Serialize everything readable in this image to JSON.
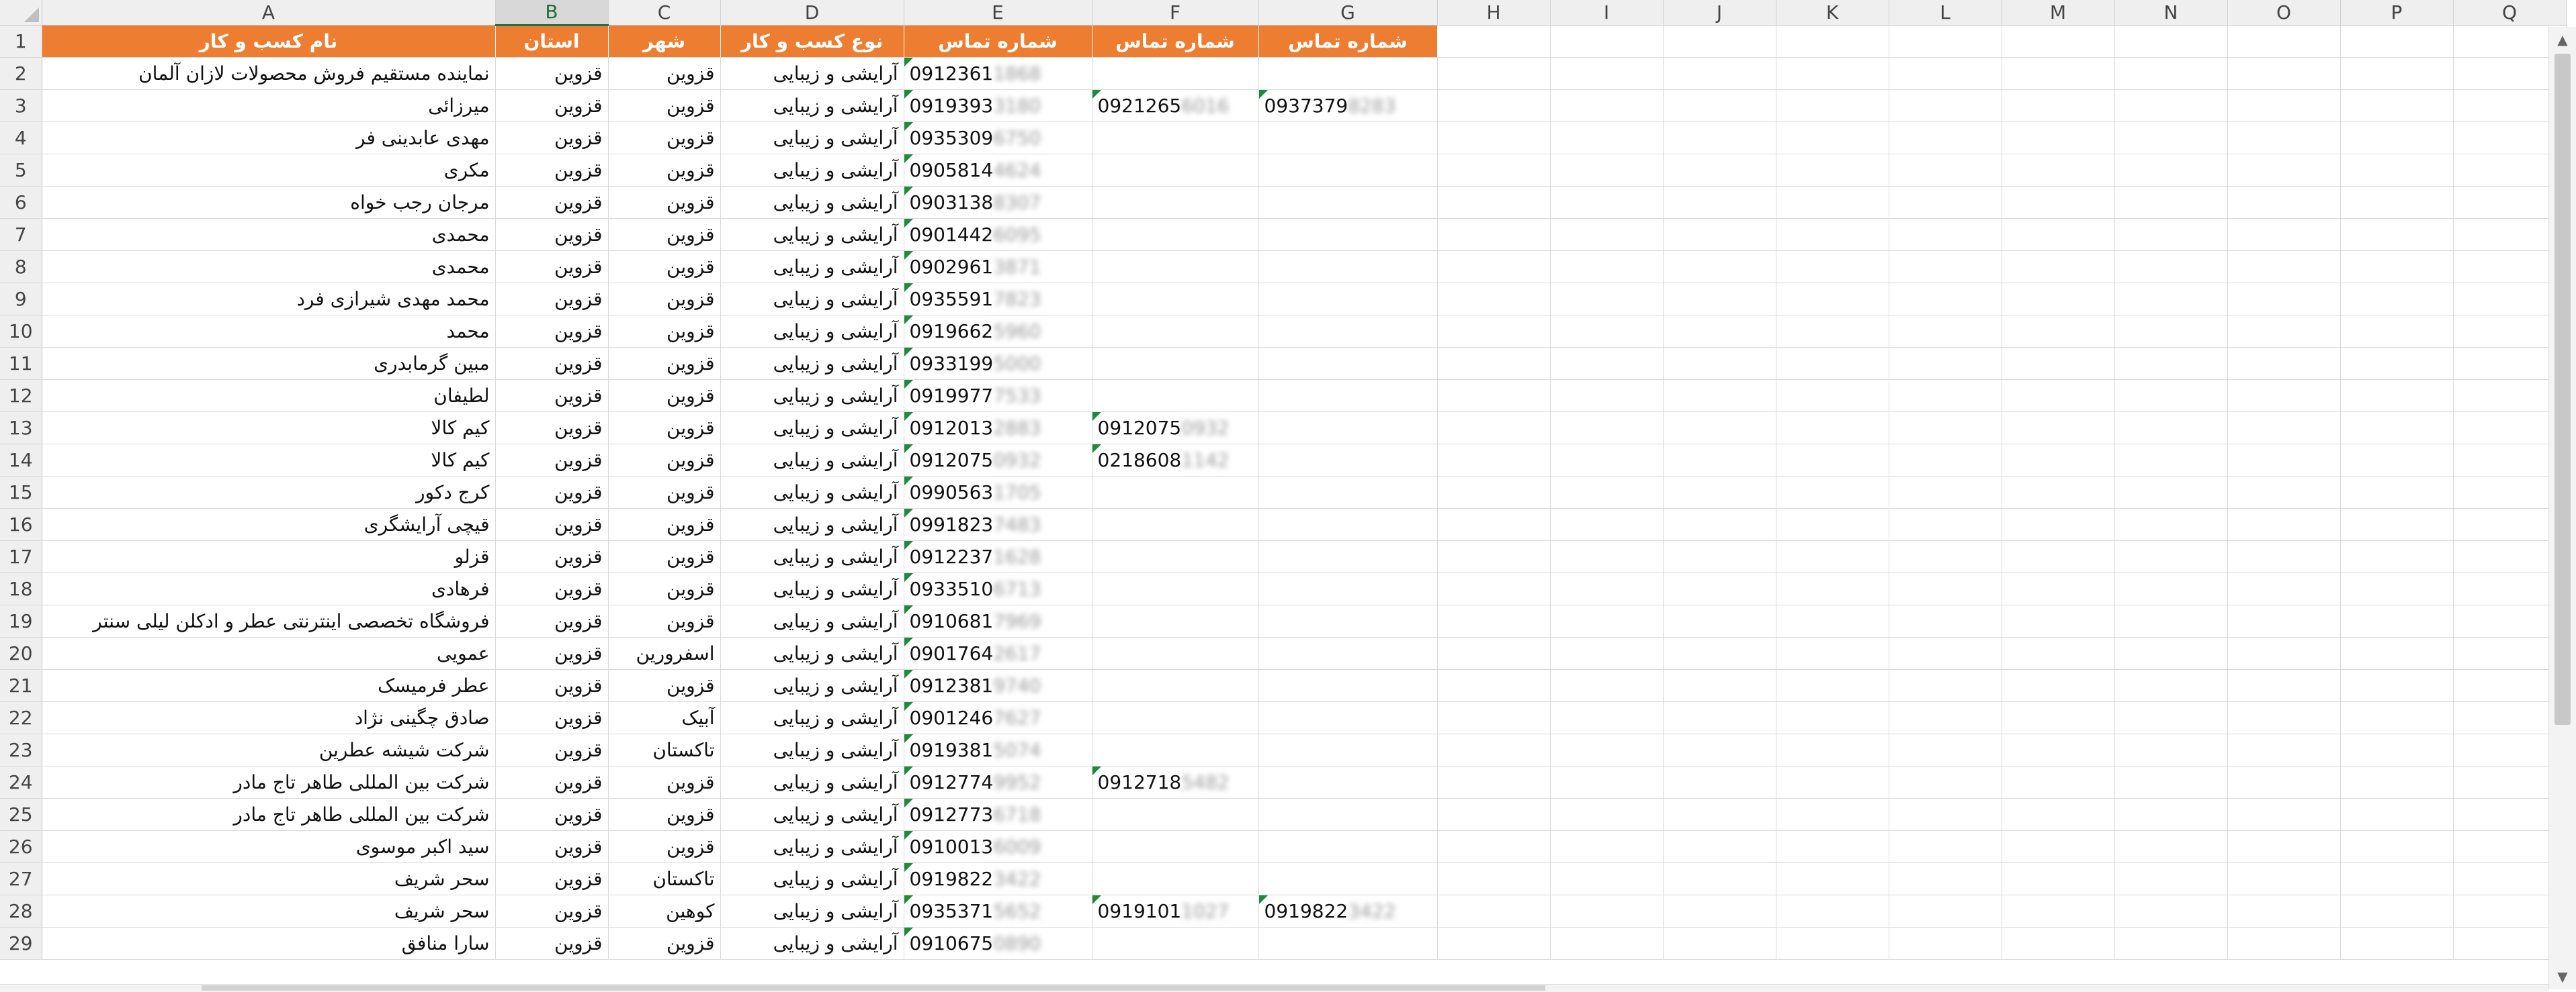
{
  "columns": [
    "A",
    "B",
    "C",
    "D",
    "E",
    "F",
    "G",
    "H",
    "I",
    "J",
    "K",
    "L",
    "M",
    "N",
    "O",
    "P",
    "Q"
  ],
  "selected_column": "B",
  "header_row": [
    "نام کسب و کار",
    "استان",
    "شهر",
    "نوع کسب و کار",
    "شماره تماس",
    "شماره تماس",
    "شماره تماس"
  ],
  "rows": [
    {
      "n": "2",
      "a": "نماینده مستقیم فروش محصولات لازان آلمان",
      "b": "قزوین",
      "c": "قزوین",
      "d": "آرایشی و زیبایی",
      "e": [
        "0912361",
        "1868"
      ],
      "f": null,
      "g": null
    },
    {
      "n": "3",
      "a": "میرزائی",
      "b": "قزوین",
      "c": "قزوین",
      "d": "آرایشی و زیبایی",
      "e": [
        "0919393",
        "3180"
      ],
      "f": [
        "0921265",
        "6016"
      ],
      "g": [
        "0937379",
        "8283"
      ]
    },
    {
      "n": "4",
      "a": "مهدی عابدینی فر",
      "b": "قزوین",
      "c": "قزوین",
      "d": "آرایشی و زیبایی",
      "e": [
        "0935309",
        "6750"
      ],
      "f": null,
      "g": null
    },
    {
      "n": "5",
      "a": "مکری",
      "b": "قزوین",
      "c": "قزوین",
      "d": "آرایشی و زیبایی",
      "e": [
        "0905814",
        "4624"
      ],
      "f": null,
      "g": null
    },
    {
      "n": "6",
      "a": "مرجان رجب خواه",
      "b": "قزوین",
      "c": "قزوین",
      "d": "آرایشی و زیبایی",
      "e": [
        "0903138",
        "8307"
      ],
      "f": null,
      "g": null
    },
    {
      "n": "7",
      "a": "محمدی",
      "b": "قزوین",
      "c": "قزوین",
      "d": "آرایشی و زیبایی",
      "e": [
        "0901442",
        "6095"
      ],
      "f": null,
      "g": null
    },
    {
      "n": "8",
      "a": "محمدی",
      "b": "قزوین",
      "c": "قزوین",
      "d": "آرایشی و زیبایی",
      "e": [
        "0902961",
        "3871"
      ],
      "f": null,
      "g": null
    },
    {
      "n": "9",
      "a": "محمد مهدی شیرازی فرد",
      "b": "قزوین",
      "c": "قزوین",
      "d": "آرایشی و زیبایی",
      "e": [
        "0935591",
        "7823"
      ],
      "f": null,
      "g": null
    },
    {
      "n": "10",
      "a": "محمد",
      "b": "قزوین",
      "c": "قزوین",
      "d": "آرایشی و زیبایی",
      "e": [
        "0919662",
        "5960"
      ],
      "f": null,
      "g": null
    },
    {
      "n": "11",
      "a": "مبین گرمابدری",
      "b": "قزوین",
      "c": "قزوین",
      "d": "آرایشی و زیبایی",
      "e": [
        "0933199",
        "5000"
      ],
      "f": null,
      "g": null
    },
    {
      "n": "12",
      "a": "لطیفان",
      "b": "قزوین",
      "c": "قزوین",
      "d": "آرایشی و زیبایی",
      "e": [
        "0919977",
        "7533"
      ],
      "f": null,
      "g": null
    },
    {
      "n": "13",
      "a": "کیم کالا",
      "b": "قزوین",
      "c": "قزوین",
      "d": "آرایشی و زیبایی",
      "e": [
        "0912013",
        "2883"
      ],
      "f": [
        "0912075",
        "0932"
      ],
      "g": null
    },
    {
      "n": "14",
      "a": "کیم کالا",
      "b": "قزوین",
      "c": "قزوین",
      "d": "آرایشی و زیبایی",
      "e": [
        "0912075",
        "0932"
      ],
      "f": [
        "0218608",
        "1142"
      ],
      "g": null
    },
    {
      "n": "15",
      "a": "کرج دکور",
      "b": "قزوین",
      "c": "قزوین",
      "d": "آرایشی و زیبایی",
      "e": [
        "0990563",
        "1705"
      ],
      "f": null,
      "g": null
    },
    {
      "n": "16",
      "a": "قیچی آرایشگری",
      "b": "قزوین",
      "c": "قزوین",
      "d": "آرایشی و زیبایی",
      "e": [
        "0991823",
        "7483"
      ],
      "f": null,
      "g": null
    },
    {
      "n": "17",
      "a": "قزلو",
      "b": "قزوین",
      "c": "قزوین",
      "d": "آرایشی و زیبایی",
      "e": [
        "0912237",
        "1628"
      ],
      "f": null,
      "g": null
    },
    {
      "n": "18",
      "a": "فرهادی",
      "b": "قزوین",
      "c": "قزوین",
      "d": "آرایشی و زیبایی",
      "e": [
        "0933510",
        "6713"
      ],
      "f": null,
      "g": null
    },
    {
      "n": "19",
      "a": "فروشگاه تخصصی اینترنتی عطر و ادکلن لیلی سنتر",
      "b": "قزوین",
      "c": "قزوین",
      "d": "آرایشی و زیبایی",
      "e": [
        "0910681",
        "7969"
      ],
      "f": null,
      "g": null
    },
    {
      "n": "20",
      "a": "عمویی",
      "b": "قزوین",
      "c": "اسفرورین",
      "d": "آرایشی و زیبایی",
      "e": [
        "0901764",
        "2617"
      ],
      "f": null,
      "g": null
    },
    {
      "n": "21",
      "a": "عطر فرمیسک",
      "b": "قزوین",
      "c": "قزوین",
      "d": "آرایشی و زیبایی",
      "e": [
        "0912381",
        "9740"
      ],
      "f": null,
      "g": null
    },
    {
      "n": "22",
      "a": "صادق چگینی نژاد",
      "b": "قزوین",
      "c": "آبیک",
      "d": "آرایشی و زیبایی",
      "e": [
        "0901246",
        "7627"
      ],
      "f": null,
      "g": null
    },
    {
      "n": "23",
      "a": "شرکت شیشه عطرین",
      "b": "قزوین",
      "c": "تاکستان",
      "d": "آرایشی و زیبایی",
      "e": [
        "0919381",
        "5074"
      ],
      "f": null,
      "g": null
    },
    {
      "n": "24",
      "a": "شرکت بین المللی طاهر تاج مادر",
      "b": "قزوین",
      "c": "قزوین",
      "d": "آرایشی و زیبایی",
      "e": [
        "0912774",
        "9952"
      ],
      "f": [
        "0912718",
        "5482"
      ],
      "g": null
    },
    {
      "n": "25",
      "a": "شرکت بین المللی طاهر تاج مادر",
      "b": "قزوین",
      "c": "قزوین",
      "d": "آرایشی و زیبایی",
      "e": [
        "0912773",
        "6718"
      ],
      "f": null,
      "g": null
    },
    {
      "n": "26",
      "a": "سید اکبر موسوی",
      "b": "قزوین",
      "c": "قزوین",
      "d": "آرایشی و زیبایی",
      "e": [
        "0910013",
        "6009"
      ],
      "f": null,
      "g": null
    },
    {
      "n": "27",
      "a": "سحر شریف",
      "b": "قزوین",
      "c": "تاکستان",
      "d": "آرایشی و زیبایی",
      "e": [
        "0919822",
        "3422"
      ],
      "f": null,
      "g": null
    },
    {
      "n": "28",
      "a": "سحر شریف",
      "b": "قزوین",
      "c": "کوهین",
      "d": "آرایشی و زیبایی",
      "e": [
        "0935371",
        "5652"
      ],
      "f": [
        "0919101",
        "1027"
      ],
      "g": [
        "0919822",
        "3422"
      ]
    },
    {
      "n": "29",
      "a": "سارا منافق",
      "b": "قزوین",
      "c": "قزوین",
      "d": "آرایشی و زیبایی",
      "e": [
        "0910675",
        "0890"
      ],
      "f": null,
      "g": null
    }
  ],
  "icons": {
    "scroll_up": "chevron-up-icon",
    "scroll_down": "chevron-down-icon"
  }
}
